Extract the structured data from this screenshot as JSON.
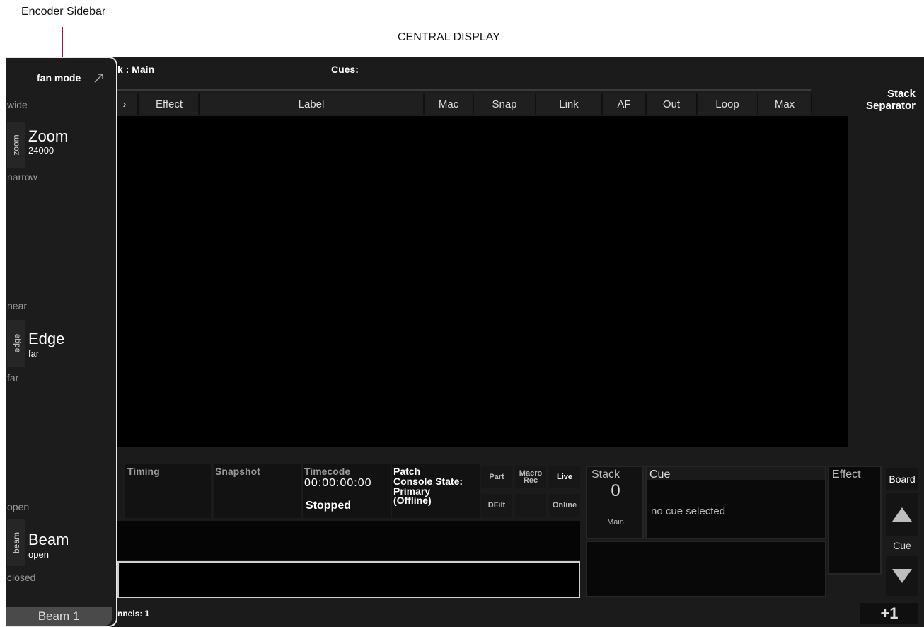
{
  "callouts": {
    "encoder_sidebar": "Encoder Sidebar",
    "central_display": "CENTRAL DISPLAY"
  },
  "header": {
    "cuelist_title": "k : Main",
    "cues_label": "Cues:",
    "stack_separator": "Stack Separator"
  },
  "columns": [
    "Effect",
    "Label",
    "Mac",
    "Snap",
    "Link",
    "AF",
    "Out",
    "Loop",
    "Max"
  ],
  "sidebar": {
    "fan_mode": "fan mode",
    "encoders": [
      {
        "top": "wide",
        "tab": "zoom",
        "name": "Zoom",
        "value": "24000",
        "bottom": "narrow"
      },
      {
        "top": "near",
        "tab": "edge",
        "name": "Edge",
        "value": "far",
        "bottom": "far"
      },
      {
        "top": "open",
        "tab": "beam",
        "name": "Beam",
        "value": "open",
        "bottom": "closed"
      }
    ],
    "page_label": "Beam 1"
  },
  "status": {
    "timing": "Timing",
    "snapshot": "Snapshot",
    "timecode_label": "Timecode",
    "timecode_value": "00:00:00:00",
    "timecode_state": "Stopped",
    "patch_label": "Patch",
    "console_state_label": "Console State:",
    "console_state_value": "Primary (Offline)",
    "buttons": {
      "part": "Part",
      "macro_rec": "Macro Rec",
      "live": "Live",
      "dfilt": "DFilt",
      "online": "Online"
    }
  },
  "playback": {
    "stack_label": "Stack",
    "stack_number": "0",
    "stack_name": "Main",
    "cue_label": "Cue",
    "cue_text": "no cue selected",
    "effect_label": "Effect",
    "board_label": "Board",
    "cue_nav_label": "Cue",
    "plus_one": "+1"
  },
  "footer": {
    "channels": "nnels: 1"
  }
}
